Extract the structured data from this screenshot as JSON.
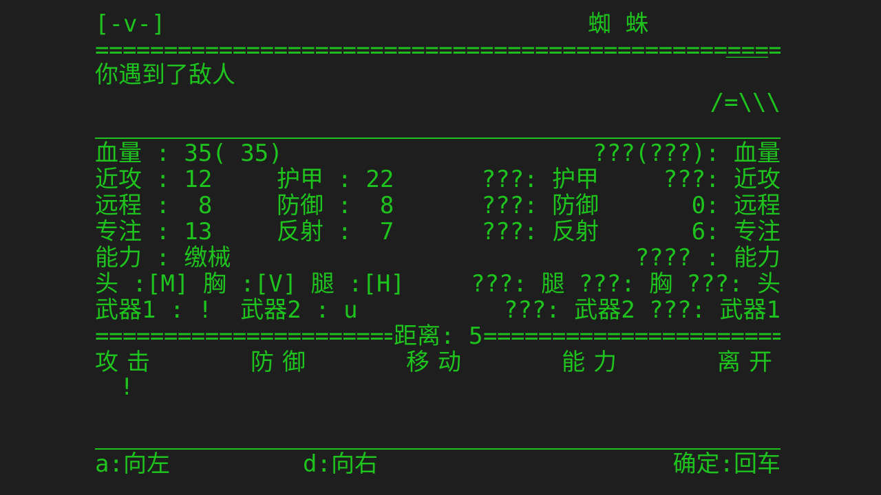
{
  "header": {
    "face": "[-v-]",
    "enemy_name": "蜘 蛛",
    "art_line1": "___",
    "art_line2": "/=\\\\\\"
  },
  "separator_eq": "================================================================================",
  "message": "你遇到了敌人",
  "player": {
    "hp": "血量 : 35( 35)",
    "melee": "近攻 : 12",
    "armor": "护甲 : 22",
    "ranged": "远程 :  8",
    "defense": "防御 :  8",
    "focus": "专注 : 13",
    "reflect": "反射 :  7",
    "ability": "能力 : 缴械",
    "equip": "头 :[M] 胸 :[V] 腿 :[H]",
    "weapons": "武器1 : !  武器2 : u"
  },
  "enemy": {
    "hp": "???(???): 血量",
    "armor": "???: 护甲",
    "melee": "???: 近攻",
    "defense": "???: 防御",
    "ranged": "0: 远程",
    "reflect": "???: 反射",
    "focus": "6: 专注",
    "ability": "???? : 能力",
    "equip": "???: 腿 ???: 胸 ???: 头",
    "weapons": "???: 武器2 ???: 武器1"
  },
  "distance": {
    "left": "======================",
    "label": "距离: 5",
    "right": "======================="
  },
  "menu": [
    {
      "label": "攻击"
    },
    {
      "label": "防御"
    },
    {
      "label": "移动"
    },
    {
      "label": "能力"
    },
    {
      "label": "离开"
    }
  ],
  "cursor": "!",
  "footer": {
    "left": "a:向左",
    "middle": "d:向右",
    "right": "确定:回车"
  },
  "colors": {
    "background": "#1e1e1e",
    "text": "#1ec31e"
  }
}
